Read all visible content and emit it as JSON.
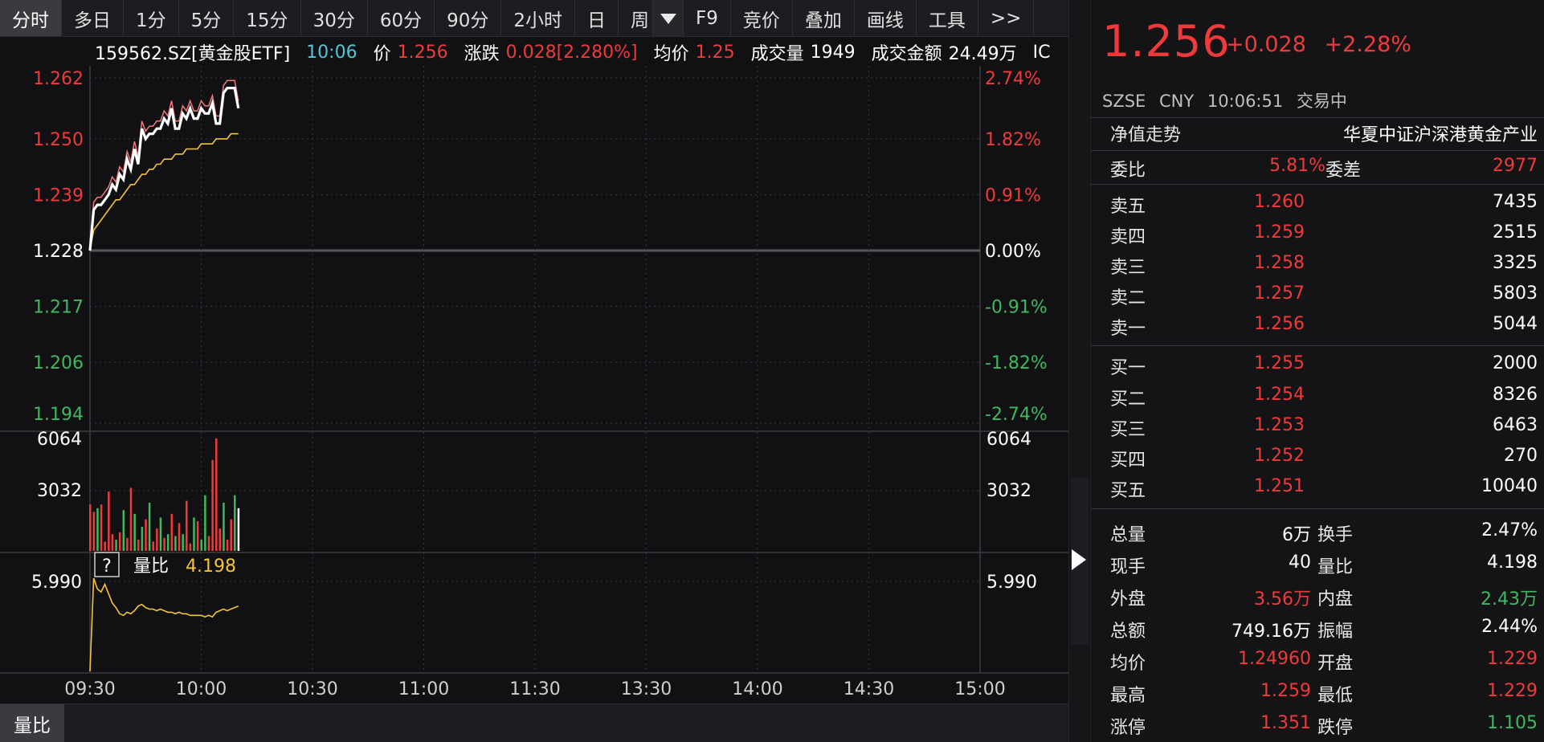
{
  "toolbar": {
    "tabs": [
      "分时",
      "多日",
      "1分",
      "5分",
      "15分",
      "30分",
      "60分",
      "90分",
      "2小时",
      "日",
      "周"
    ],
    "extra": [
      "F9",
      "竞价",
      "叠加",
      "画线",
      "工具",
      ">>"
    ]
  },
  "info": {
    "symbol": "159562.SZ[黄金股ETF]",
    "time": "10:06",
    "price_label": "价",
    "price": "1.256",
    "chg_label": "涨跌",
    "chg": "0.028[2.280%]",
    "avg_label": "均价",
    "avg": "1.25",
    "vol_label": "成交量",
    "vol": "1949",
    "amt_label": "成交金额",
    "amt": "24.49万",
    "trail": "IC"
  },
  "chart": {
    "left_axis": [
      "1.262",
      "1.250",
      "1.239",
      "1.228",
      "1.217",
      "1.206",
      "1.194"
    ],
    "right_axis": [
      "2.74%",
      "1.82%",
      "0.91%",
      "0.00%",
      "-0.91%",
      "-1.82%",
      "-2.74%"
    ],
    "vol_axis_left": [
      "6064",
      "3032"
    ],
    "vol_axis_right": [
      "6064",
      "3032"
    ],
    "ratio_help": "?",
    "ratio_label": "量比",
    "ratio_value": "4.198",
    "ratio_axis_left": "5.990",
    "ratio_axis_right": "5.990",
    "time_labels": [
      "09:30",
      "10:00",
      "10:30",
      "11:00",
      "11:30",
      "13:30",
      "14:00",
      "14:30",
      "15:00"
    ],
    "colors": {
      "up": "#f03a3a",
      "down": "#3fb85f",
      "price": "#ffffff",
      "avg": "#f4c338",
      "ratio": "#f4c338"
    }
  },
  "chart_data": {
    "type": "line",
    "x_range": [
      "09:30",
      "15:00"
    ],
    "ylim": [
      1.194,
      1.262
    ],
    "price": [
      1.228,
      1.236,
      1.237,
      1.237,
      1.238,
      1.239,
      1.241,
      1.24,
      1.243,
      1.242,
      1.246,
      1.244,
      1.248,
      1.245,
      1.252,
      1.25,
      1.251,
      1.251,
      1.252,
      1.252,
      1.254,
      1.253,
      1.256,
      1.252,
      1.252,
      1.255,
      1.254,
      1.256,
      1.254,
      1.254,
      1.256,
      1.255,
      1.255,
      1.257,
      1.253,
      1.253,
      1.259,
      1.26,
      1.26,
      1.26,
      1.256
    ],
    "average": [
      1.228,
      1.232,
      1.233,
      1.234,
      1.235,
      1.236,
      1.237,
      1.238,
      1.238,
      1.239,
      1.24,
      1.241,
      1.241,
      1.242,
      1.243,
      1.243,
      1.244,
      1.244,
      1.245,
      1.245,
      1.246,
      1.246,
      1.246,
      1.247,
      1.247,
      1.247,
      1.248,
      1.248,
      1.248,
      1.248,
      1.249,
      1.249,
      1.249,
      1.249,
      1.25,
      1.25,
      1.25,
      1.25,
      1.251,
      1.251,
      1.251
    ],
    "volume": [
      2500,
      2100,
      2300,
      2500,
      500,
      3200,
      900,
      600,
      1000,
      2200,
      700,
      3400,
      2000,
      600,
      1300,
      1700,
      2600,
      500,
      1200,
      1800,
      700,
      900,
      2000,
      800,
      1500,
      900,
      2700,
      400,
      1800,
      1600,
      600,
      3000,
      800,
      4900,
      6064,
      1200,
      2600,
      600,
      1700,
      3000,
      2300
    ],
    "volume_dir": [
      "up",
      "up",
      "down",
      "up",
      "up",
      "up",
      "up",
      "down",
      "up",
      "down",
      "up",
      "up",
      "down",
      "up",
      "down",
      "up",
      "down",
      "up",
      "up",
      "down",
      "up",
      "down",
      "up",
      "down",
      "up",
      "down",
      "up",
      "up",
      "down",
      "up",
      "down",
      "down",
      "up",
      "up",
      "up",
      "up",
      "down",
      "up",
      "up",
      "down",
      "down"
    ],
    "volume_ratio": [
      0.0,
      5.99,
      5.3,
      5.1,
      5.6,
      5.0,
      4.4,
      4.1,
      3.7,
      3.6,
      3.8,
      3.7,
      3.9,
      4.2,
      4.3,
      4.1,
      4.0,
      4.0,
      3.9,
      4.0,
      3.9,
      3.8,
      3.8,
      3.7,
      3.8,
      3.7,
      3.7,
      3.6,
      3.6,
      3.6,
      3.6,
      3.5,
      3.6,
      3.5,
      3.8,
      3.9,
      4.0,
      3.9,
      4.0,
      4.1,
      4.198
    ]
  },
  "panel": {
    "price": "1.256",
    "chg": "+0.028",
    "pct": "+2.28%",
    "exchange": "SZSE",
    "currency": "CNY",
    "time": "10:06:51",
    "state": "交易中",
    "nav_label": "净值走势",
    "index_name": "华夏中证沪深港黄金产业",
    "weibi_label": "委比",
    "weibi": "5.81%",
    "weicha_label": "委差",
    "weicha": "2977",
    "asks": [
      {
        "label": "卖五",
        "price": "1.260",
        "vol": "7435"
      },
      {
        "label": "卖四",
        "price": "1.259",
        "vol": "2515"
      },
      {
        "label": "卖三",
        "price": "1.258",
        "vol": "3325"
      },
      {
        "label": "卖二",
        "price": "1.257",
        "vol": "5803"
      },
      {
        "label": "卖一",
        "price": "1.256",
        "vol": "5044"
      }
    ],
    "bids": [
      {
        "label": "买一",
        "price": "1.255",
        "vol": "2000"
      },
      {
        "label": "买二",
        "price": "1.254",
        "vol": "8326"
      },
      {
        "label": "买三",
        "price": "1.253",
        "vol": "6463"
      },
      {
        "label": "买四",
        "price": "1.252",
        "vol": "270"
      },
      {
        "label": "买五",
        "price": "1.251",
        "vol": "10040"
      }
    ],
    "stats": [
      {
        "l1": "总量",
        "v1": "6万",
        "c1": "white",
        "l2": "换手",
        "v2": "2.47%",
        "c2": "white"
      },
      {
        "l1": "现手",
        "v1": "40",
        "c1": "white",
        "l2": "量比",
        "v2": "4.198",
        "c2": "white"
      },
      {
        "l1": "外盘",
        "v1": "3.56万",
        "c1": "red",
        "l2": "内盘",
        "v2": "2.43万",
        "c2": "green"
      },
      {
        "l1": "总额",
        "v1": "749.16万",
        "c1": "white",
        "l2": "振幅",
        "v2": "2.44%",
        "c2": "white"
      },
      {
        "l1": "均价",
        "v1": "1.24960",
        "c1": "red",
        "l2": "开盘",
        "v2": "1.229",
        "c2": "red"
      },
      {
        "l1": "最高",
        "v1": "1.259",
        "c1": "red",
        "l2": "最低",
        "v2": "1.229",
        "c2": "red"
      },
      {
        "l1": "涨停",
        "v1": "1.351",
        "c1": "red",
        "l2": "跌停",
        "v2": "1.105",
        "c2": "green"
      }
    ]
  },
  "bottom": {
    "tab": "量比"
  }
}
